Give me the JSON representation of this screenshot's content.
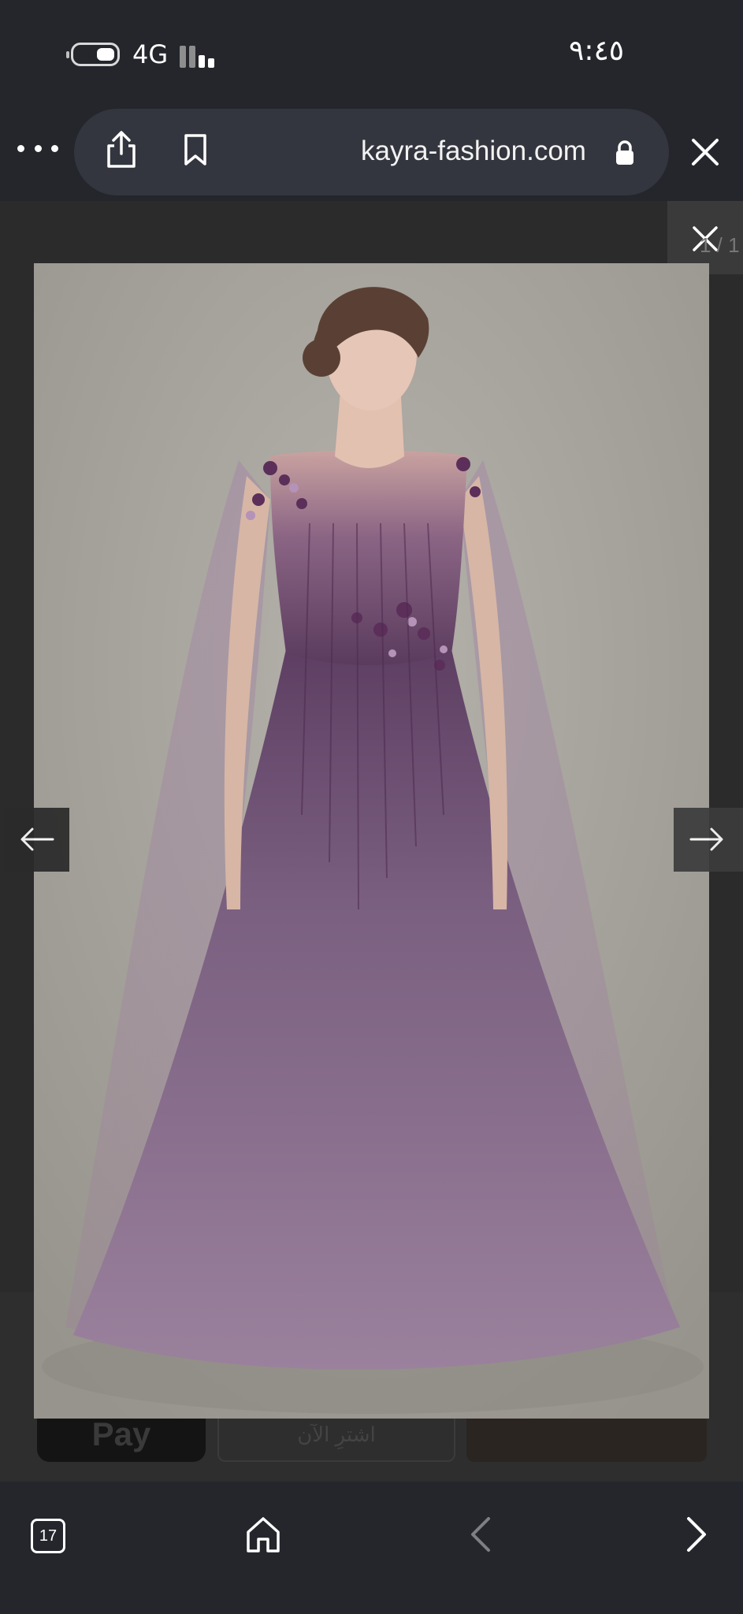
{
  "status_bar": {
    "network": "4G",
    "time": "٩:٤٥"
  },
  "browser": {
    "url": "kayra-fashion.com",
    "icons": [
      "more-icon",
      "share-icon",
      "bookmark-icon",
      "lock-icon",
      "close-icon"
    ]
  },
  "page": {
    "apple_pay_label": " Pay",
    "buy_now_label": "اشترِ الآن"
  },
  "lightbox": {
    "counter": "1 / 1",
    "image_alt": "Lavender tulle evening gown with cape sleeves and floral embellishment"
  },
  "toolbar": {
    "tabs_count": "17",
    "icons": [
      "tabs-icon",
      "home-icon",
      "back-icon",
      "forward-icon"
    ]
  },
  "colors": {
    "chrome_bg": "#24262c",
    "pill_bg": "#33363e",
    "gown": "#8a6f8e",
    "backdrop": "#a9a59f"
  }
}
